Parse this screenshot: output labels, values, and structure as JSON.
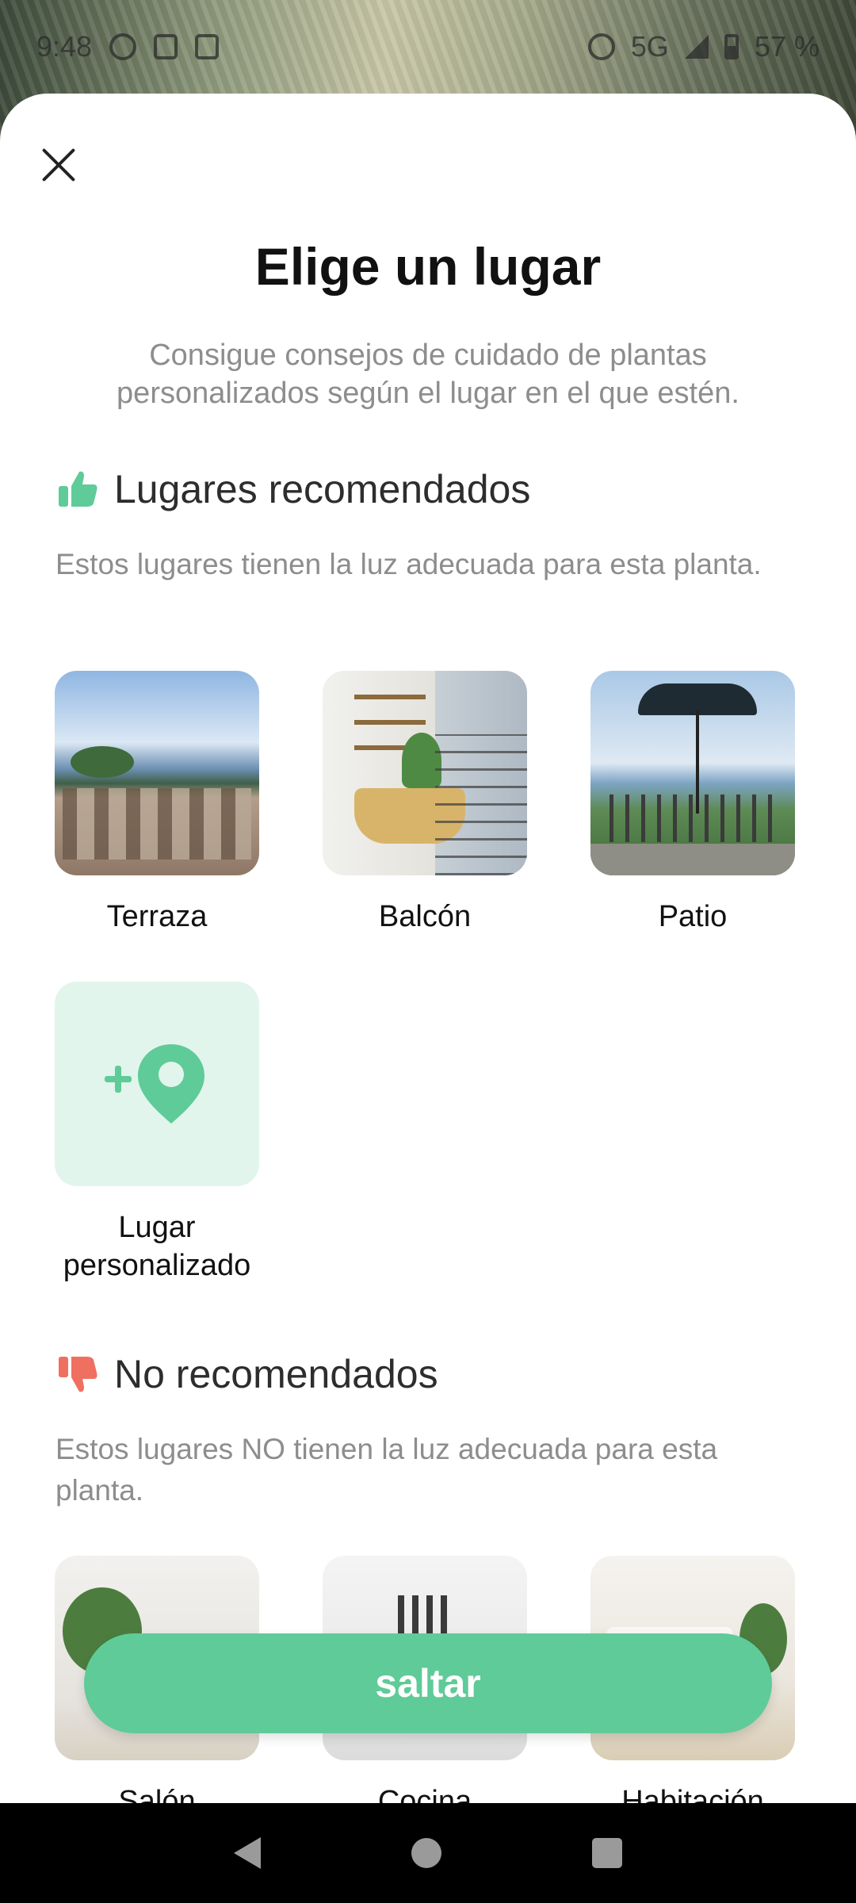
{
  "status_bar": {
    "time": "9:48",
    "network": "5G",
    "battery": "57 %"
  },
  "sheet": {
    "title": "Elige un lugar",
    "subtitle": "Consigue consejos de cuidado de plantas personalizados según el lugar en el que estén."
  },
  "recommended": {
    "heading": "Lugares recomendados",
    "description": "Estos lugares tienen la luz adecuada para esta planta.",
    "icon": "thumbs-up-icon",
    "icon_color": "#5fcb98",
    "places": [
      {
        "label": "Terraza"
      },
      {
        "label": "Balcón"
      },
      {
        "label": "Patio"
      },
      {
        "label": "Lugar personalizado"
      }
    ]
  },
  "not_recommended": {
    "heading": "No recomendados",
    "description": "Estos lugares NO tienen la luz adecuada para esta planta.",
    "icon": "thumbs-down-icon",
    "icon_color": "#ef6f61",
    "places": [
      {
        "label": "Salón"
      },
      {
        "label": "Cocina"
      },
      {
        "label": "Habitación"
      }
    ]
  },
  "actions": {
    "skip_label": "saltar",
    "accent_color": "#5fcb98"
  }
}
